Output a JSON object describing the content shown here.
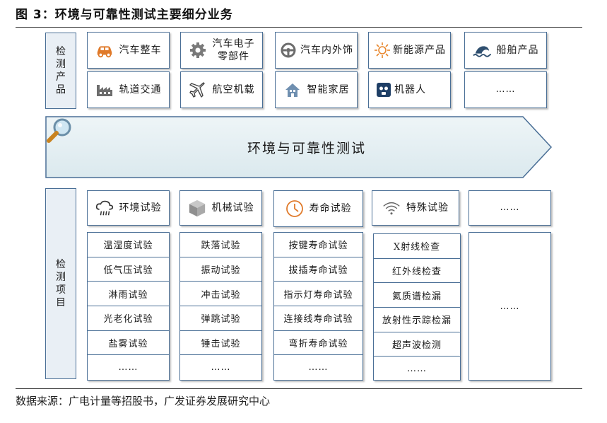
{
  "figure_title": "图 3：环境与可靠性测试主要细分业务",
  "source": "数据来源：广电计量等招股书，广发证券发展研究中心",
  "products_label": [
    "检",
    "测",
    "产",
    "品"
  ],
  "items_label": [
    "检",
    "测",
    "项",
    "目"
  ],
  "products_row1": [
    {
      "label": "汽车整车",
      "icon": "car-icon"
    },
    {
      "label_lines": [
        "汽车电子",
        "零部件"
      ],
      "icon": "gear-icon"
    },
    {
      "label": "汽车内外饰",
      "icon": "steering-wheel-icon"
    },
    {
      "label": "新能源产品",
      "icon": "sun-icon"
    },
    {
      "label": "船舶产品",
      "icon": "ship-wave-icon"
    }
  ],
  "products_row2": [
    {
      "label": "轨道交通",
      "icon": "factory-icon"
    },
    {
      "label": "航空机载",
      "icon": "airplane-icon"
    },
    {
      "label": "智能家居",
      "icon": "house-icon"
    },
    {
      "label": "机器人",
      "icon": "robot-icon"
    },
    {
      "label": "……"
    }
  ],
  "banner": {
    "label": "环境与可靠性测试",
    "icon": "magnifier-icon"
  },
  "categories": [
    {
      "label": "环境试验",
      "icon": "cloud-rain-icon"
    },
    {
      "label": "机械试验",
      "icon": "cube-icon"
    },
    {
      "label": "寿命试验",
      "icon": "clock-icon"
    },
    {
      "label": "特殊试验",
      "icon": "wifi-signal-icon"
    },
    {
      "label": "……"
    }
  ],
  "tests": [
    [
      "温湿度试验",
      "低气压试验",
      "淋雨试验",
      "光老化试验",
      "盐雾试验",
      "……"
    ],
    [
      "跌落试验",
      "振动试验",
      "冲击试验",
      "弹跳试验",
      "锤击试验",
      "……"
    ],
    [
      "按键寿命试验",
      "拔插寿命试验",
      "指示灯寿命试验",
      "连接线寿命试验",
      "弯折寿命试验",
      "……"
    ],
    [
      "X射线检查",
      "红外线检查",
      "氦质谱检漏",
      "放射性示踪检漏",
      "超声波检测",
      "……"
    ]
  ],
  "tests_extra": "……"
}
